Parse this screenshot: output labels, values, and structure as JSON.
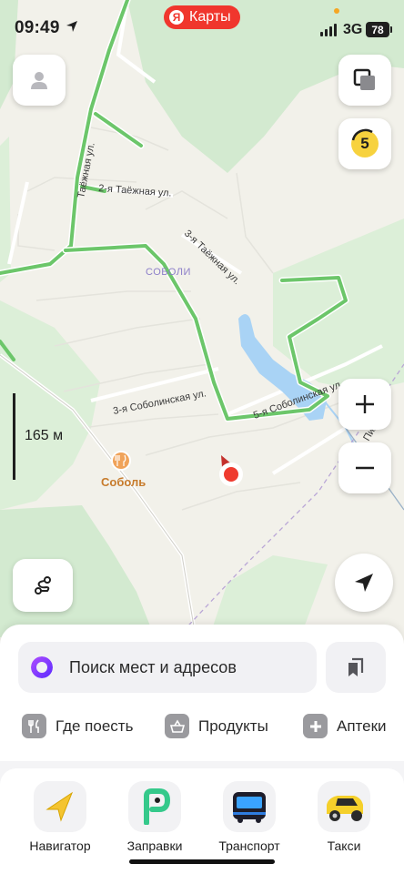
{
  "status_bar": {
    "time": "09:49",
    "network": "3G",
    "battery": "78"
  },
  "app": {
    "name": "Карты",
    "logo_letter": "Я"
  },
  "map": {
    "street_labels": [
      "Таёжная ул.",
      "2-я Таёжная ул.",
      "3-я Таёжная ул.",
      "3-я Соболинская ул.",
      "5-я Соболинская ул.",
      "Пижинен"
    ],
    "place_label": "СОБОЛИ",
    "poi_label": "Соболь",
    "scale": "165 м",
    "traffic_level": "5"
  },
  "search": {
    "placeholder": "Поиск мест и адресов"
  },
  "categories": [
    {
      "label": "Где поесть",
      "icon": "fork-knife-icon"
    },
    {
      "label": "Продукты",
      "icon": "basket-icon"
    },
    {
      "label": "Аптеки",
      "icon": "pharmacy-cross-icon"
    }
  ],
  "services": [
    {
      "label": "Навигатор",
      "icon": "navigator-arrow-icon"
    },
    {
      "label": "Заправки",
      "icon": "fuel-p-icon"
    },
    {
      "label": "Транспорт",
      "icon": "bus-icon"
    },
    {
      "label": "Такси",
      "icon": "taxi-icon"
    }
  ],
  "colors": {
    "brand_red": "#f0362d",
    "road_green": "#6cc66a",
    "water": "#a9d3f5",
    "accent_purple": "#7a34ff"
  }
}
